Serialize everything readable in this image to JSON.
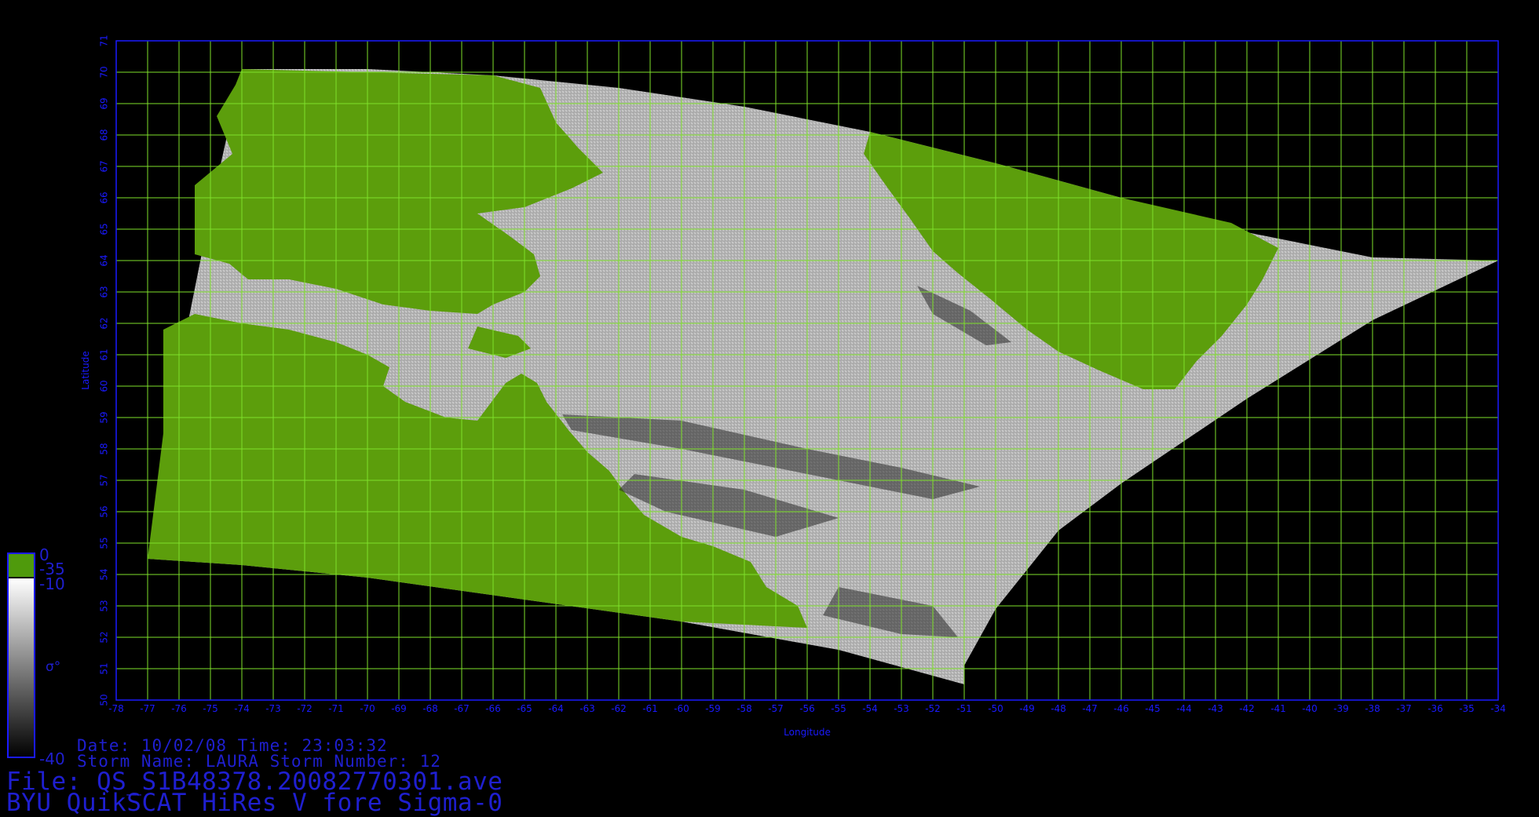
{
  "map": {
    "xlabel": "Longitude",
    "ylabel": "Latitude",
    "lon_range": [
      -78,
      -34
    ],
    "lat_range": [
      50,
      71
    ],
    "lon_ticks": [
      -78,
      -77,
      -76,
      -75,
      -74,
      -73,
      -72,
      -71,
      -70,
      -69,
      -68,
      -67,
      -66,
      -65,
      -64,
      -63,
      -62,
      -61,
      -60,
      -59,
      -58,
      -57,
      -56,
      -55,
      -54,
      -53,
      -52,
      -51,
      -50,
      -49,
      -48,
      -47,
      -46,
      -45,
      -44,
      -43,
      -42,
      -41,
      -40,
      -39,
      -38,
      -37,
      -36,
      -35,
      -34
    ],
    "lat_ticks": [
      50,
      51,
      52,
      53,
      54,
      55,
      56,
      57,
      58,
      59,
      60,
      61,
      62,
      63,
      64,
      65,
      66,
      67,
      68,
      69,
      70,
      71
    ],
    "grid": true,
    "grid_color": "#7ee02a",
    "axis_color": "#1a1aff",
    "land_color": "#5c9e0c",
    "swath_points": [
      [
        -74,
        70.1
      ],
      [
        -70,
        70.1
      ],
      [
        -66,
        69.9
      ],
      [
        -62,
        69.5
      ],
      [
        -58,
        68.9
      ],
      [
        -54,
        68.1
      ],
      [
        -50,
        67.1
      ],
      [
        -46,
        66.0
      ],
      [
        -42,
        64.9
      ],
      [
        -38,
        64.1
      ],
      [
        -34,
        64.0
      ],
      [
        -38,
        62.1
      ],
      [
        -42,
        59.6
      ],
      [
        -46,
        56.9
      ],
      [
        -48,
        55.4
      ],
      [
        -50,
        52.9
      ],
      [
        -51,
        51.1
      ],
      [
        -51,
        50.5
      ],
      [
        -55,
        51.6
      ],
      [
        -60,
        52.5
      ],
      [
        -65,
        53.2
      ],
      [
        -70,
        53.9
      ],
      [
        -74,
        54.3
      ],
      [
        -77,
        54.5
      ],
      [
        -76,
        60.6
      ],
      [
        -75,
        65.6
      ]
    ]
  },
  "colorbar": {
    "labels": [
      "0",
      "-35",
      "-10",
      "-40"
    ],
    "symbol": "σ°",
    "land_color": "#4f9a0c"
  },
  "info": {
    "date_time": "Date: 10/02/08   Time: 23:03:32",
    "storm": "Storm Name: LAURA   Storm Number: 12",
    "file": "File: QS_S1B48378.20082770301.ave",
    "product": "BYU QuikSCAT HiRes V fore Sigma-0"
  }
}
